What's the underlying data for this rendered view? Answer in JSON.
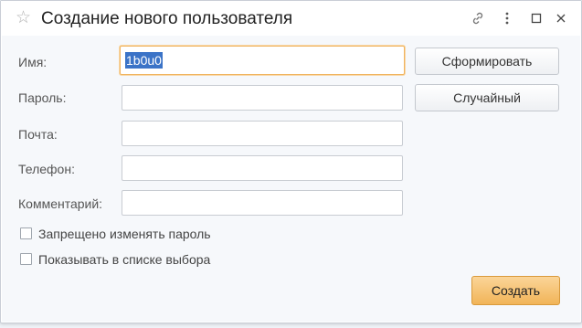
{
  "window": {
    "title": "Создание нового пользователя",
    "icons": [
      "star-icon",
      "link-icon",
      "more-icon",
      "maximize-icon",
      "close-icon"
    ]
  },
  "form": {
    "fields": [
      {
        "label": "Имя:",
        "value": "1b0u0"
      },
      {
        "label": "Пароль:",
        "value": ""
      },
      {
        "label": "Почта:",
        "value": ""
      },
      {
        "label": "Телефон:",
        "value": ""
      },
      {
        "label": "Комментарий:",
        "value": ""
      }
    ],
    "checkboxes": [
      {
        "label": "Запрещено изменять пароль",
        "checked": false
      },
      {
        "label": "Показывать в списке выбора",
        "checked": false
      }
    ]
  },
  "buttons": {
    "generate": "Сформировать",
    "random": "Случайный",
    "create": "Создать"
  },
  "colors": {
    "accent_primary": "#f1b458",
    "focus_border": "#f0b35e",
    "selection": "#3b73c7"
  }
}
